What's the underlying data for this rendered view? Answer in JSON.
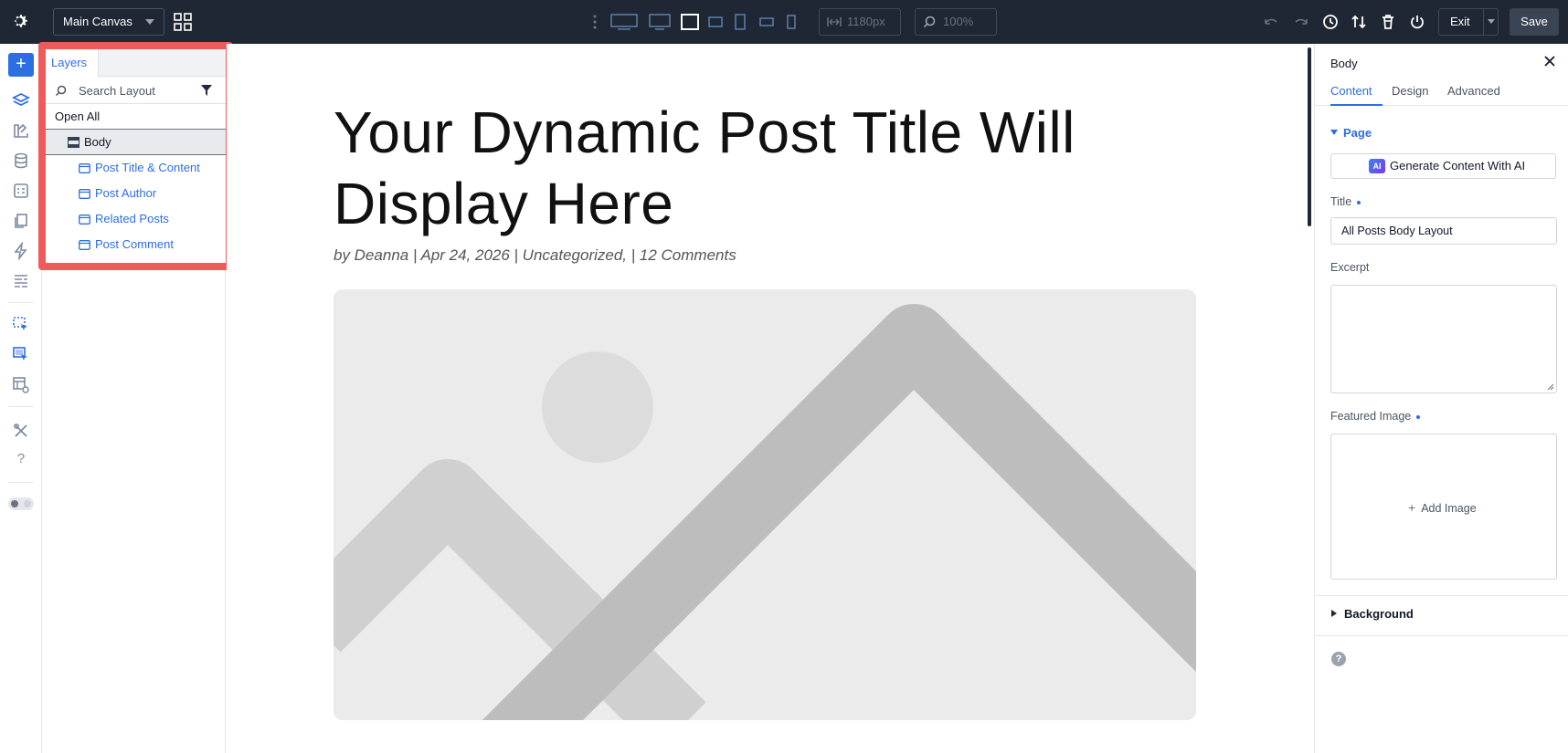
{
  "topbar": {
    "canvas_select": "Main Canvas",
    "width_value": "1180px",
    "zoom_value": "100%",
    "exit_label": "Exit",
    "save_label": "Save"
  },
  "layers": {
    "tab_label": "Layers",
    "search_placeholder": "Search Layout",
    "open_all": "Open All",
    "body_label": "Body",
    "items": [
      "Post Title & Content",
      "Post Author",
      "Related Posts",
      "Post Comment"
    ]
  },
  "canvas": {
    "title_line1": "Your Dynamic Post Title Will",
    "title_line2": "Display Here",
    "meta": "by Deanna | Apr 24, 2026 | Uncategorized, | 12 Comments"
  },
  "settings": {
    "title": "Body",
    "tabs": [
      "Content",
      "Design",
      "Advanced"
    ],
    "page_section": "Page",
    "ai_badge": "AI",
    "ai_button": "Generate Content With AI",
    "title_label": "Title",
    "title_value": "All Posts Body Layout",
    "excerpt_label": "Excerpt",
    "featured_label": "Featured Image",
    "add_image": "Add Image",
    "background_section": "Background",
    "help_glyph": "?"
  },
  "colors": {
    "topbar_bg": "#1e2733",
    "accent": "#2d6ee3",
    "highlight_frame": "#ef5a5a"
  }
}
